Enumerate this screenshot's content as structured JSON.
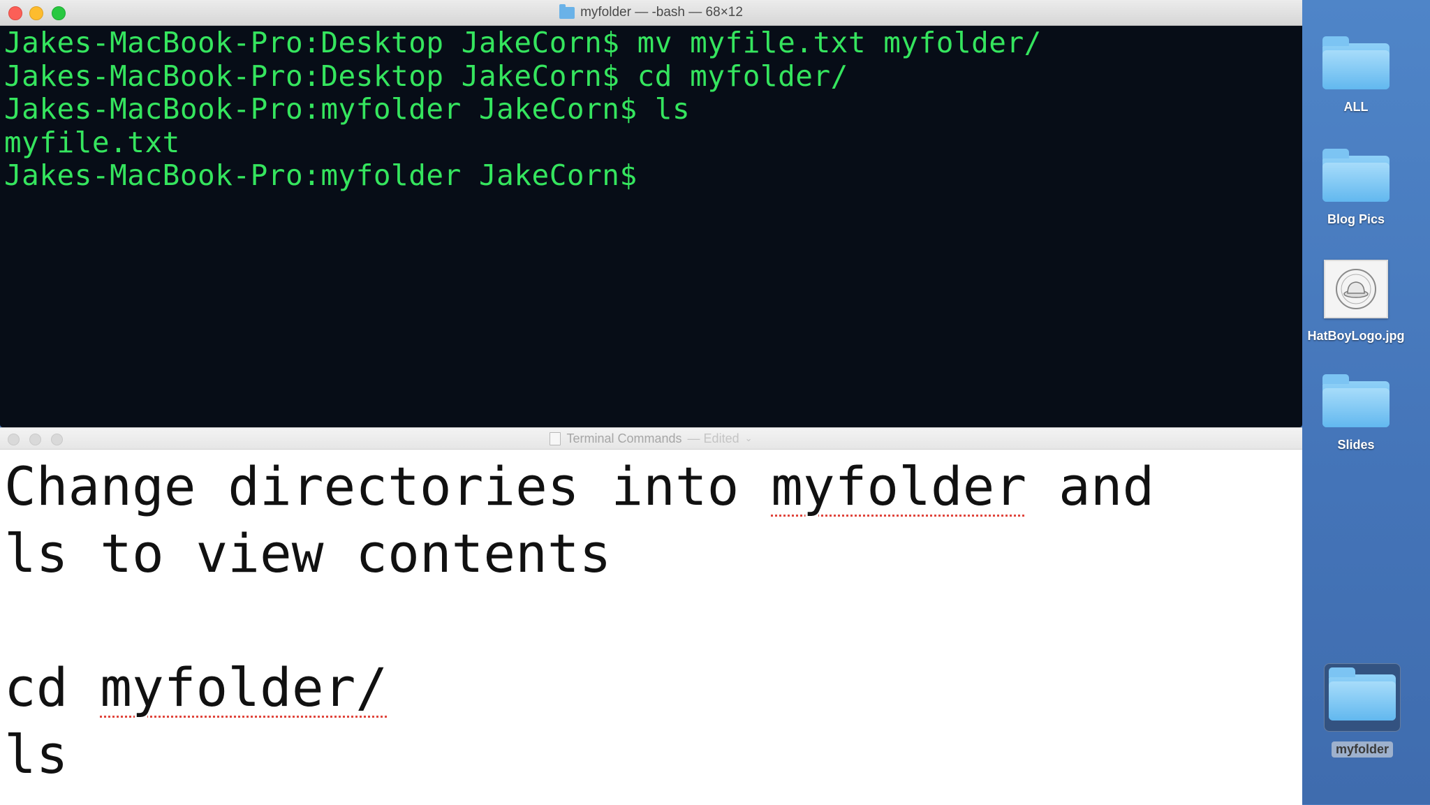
{
  "terminal": {
    "title": "myfolder — -bash — 68×12",
    "lines": [
      "Jakes-MacBook-Pro:Desktop JakeCorn$ mv myfile.txt myfolder/",
      "Jakes-MacBook-Pro:Desktop JakeCorn$ cd myfolder/",
      "Jakes-MacBook-Pro:myfolder JakeCorn$ ls",
      "myfile.txt",
      "Jakes-MacBook-Pro:myfolder JakeCorn$ "
    ],
    "text_color": "#35e55e",
    "background_color": "#070d17"
  },
  "textedit": {
    "title": "Terminal Commands",
    "status": "— Edited",
    "doc": {
      "line1_a": "Change directories into ",
      "line1_b": "myfolder",
      "line1_c": " and",
      "line2": "ls to view contents",
      "line4_a": "cd ",
      "line4_b": "myfolder/",
      "line5": "ls"
    }
  },
  "desktop": {
    "icons": [
      {
        "label": "ALL",
        "type": "folder-icon"
      },
      {
        "label": "Blog Pics",
        "type": "folder-icon"
      },
      {
        "label": "HatBoyLogo.jpg",
        "type": "image-file-icon"
      },
      {
        "label": "Slides",
        "type": "folder-icon"
      },
      {
        "label": "myfolder",
        "type": "folder-icon",
        "selected": true
      }
    ]
  }
}
